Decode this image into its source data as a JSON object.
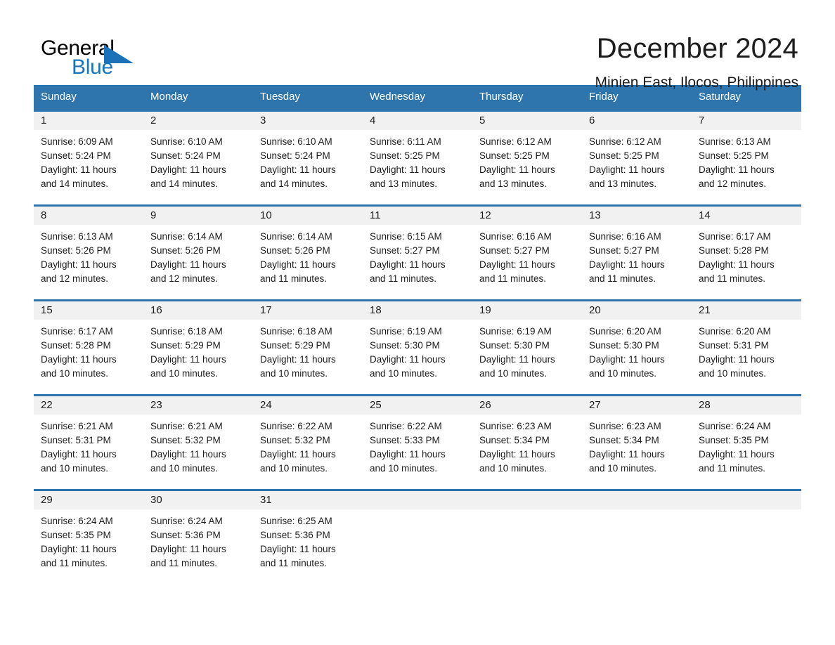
{
  "brand": {
    "name_part1": "General",
    "name_part2": "Blue",
    "accent_color": "#1b72b8"
  },
  "header": {
    "title": "December 2024",
    "subtitle": "Minien East, Ilocos, Philippines"
  },
  "theme": {
    "header_blue": "#2e75ad",
    "day_strip_gray": "#f1f1f1",
    "text_color": "#1d1d1d"
  },
  "weekdays": [
    "Sunday",
    "Monday",
    "Tuesday",
    "Wednesday",
    "Thursday",
    "Friday",
    "Saturday"
  ],
  "labels": {
    "sunrise_prefix": "Sunrise:",
    "sunset_prefix": "Sunset:",
    "daylight_prefix": "Daylight:"
  },
  "weeks": [
    [
      {
        "day": "1",
        "sunrise": "Sunrise: 6:09 AM",
        "sunset": "Sunset: 5:24 PM",
        "daylight_l1": "Daylight: 11 hours",
        "daylight_l2": "and 14 minutes."
      },
      {
        "day": "2",
        "sunrise": "Sunrise: 6:10 AM",
        "sunset": "Sunset: 5:24 PM",
        "daylight_l1": "Daylight: 11 hours",
        "daylight_l2": "and 14 minutes."
      },
      {
        "day": "3",
        "sunrise": "Sunrise: 6:10 AM",
        "sunset": "Sunset: 5:24 PM",
        "daylight_l1": "Daylight: 11 hours",
        "daylight_l2": "and 14 minutes."
      },
      {
        "day": "4",
        "sunrise": "Sunrise: 6:11 AM",
        "sunset": "Sunset: 5:25 PM",
        "daylight_l1": "Daylight: 11 hours",
        "daylight_l2": "and 13 minutes."
      },
      {
        "day": "5",
        "sunrise": "Sunrise: 6:12 AM",
        "sunset": "Sunset: 5:25 PM",
        "daylight_l1": "Daylight: 11 hours",
        "daylight_l2": "and 13 minutes."
      },
      {
        "day": "6",
        "sunrise": "Sunrise: 6:12 AM",
        "sunset": "Sunset: 5:25 PM",
        "daylight_l1": "Daylight: 11 hours",
        "daylight_l2": "and 13 minutes."
      },
      {
        "day": "7",
        "sunrise": "Sunrise: 6:13 AM",
        "sunset": "Sunset: 5:25 PM",
        "daylight_l1": "Daylight: 11 hours",
        "daylight_l2": "and 12 minutes."
      }
    ],
    [
      {
        "day": "8",
        "sunrise": "Sunrise: 6:13 AM",
        "sunset": "Sunset: 5:26 PM",
        "daylight_l1": "Daylight: 11 hours",
        "daylight_l2": "and 12 minutes."
      },
      {
        "day": "9",
        "sunrise": "Sunrise: 6:14 AM",
        "sunset": "Sunset: 5:26 PM",
        "daylight_l1": "Daylight: 11 hours",
        "daylight_l2": "and 12 minutes."
      },
      {
        "day": "10",
        "sunrise": "Sunrise: 6:14 AM",
        "sunset": "Sunset: 5:26 PM",
        "daylight_l1": "Daylight: 11 hours",
        "daylight_l2": "and 11 minutes."
      },
      {
        "day": "11",
        "sunrise": "Sunrise: 6:15 AM",
        "sunset": "Sunset: 5:27 PM",
        "daylight_l1": "Daylight: 11 hours",
        "daylight_l2": "and 11 minutes."
      },
      {
        "day": "12",
        "sunrise": "Sunrise: 6:16 AM",
        "sunset": "Sunset: 5:27 PM",
        "daylight_l1": "Daylight: 11 hours",
        "daylight_l2": "and 11 minutes."
      },
      {
        "day": "13",
        "sunrise": "Sunrise: 6:16 AM",
        "sunset": "Sunset: 5:27 PM",
        "daylight_l1": "Daylight: 11 hours",
        "daylight_l2": "and 11 minutes."
      },
      {
        "day": "14",
        "sunrise": "Sunrise: 6:17 AM",
        "sunset": "Sunset: 5:28 PM",
        "daylight_l1": "Daylight: 11 hours",
        "daylight_l2": "and 11 minutes."
      }
    ],
    [
      {
        "day": "15",
        "sunrise": "Sunrise: 6:17 AM",
        "sunset": "Sunset: 5:28 PM",
        "daylight_l1": "Daylight: 11 hours",
        "daylight_l2": "and 10 minutes."
      },
      {
        "day": "16",
        "sunrise": "Sunrise: 6:18 AM",
        "sunset": "Sunset: 5:29 PM",
        "daylight_l1": "Daylight: 11 hours",
        "daylight_l2": "and 10 minutes."
      },
      {
        "day": "17",
        "sunrise": "Sunrise: 6:18 AM",
        "sunset": "Sunset: 5:29 PM",
        "daylight_l1": "Daylight: 11 hours",
        "daylight_l2": "and 10 minutes."
      },
      {
        "day": "18",
        "sunrise": "Sunrise: 6:19 AM",
        "sunset": "Sunset: 5:30 PM",
        "daylight_l1": "Daylight: 11 hours",
        "daylight_l2": "and 10 minutes."
      },
      {
        "day": "19",
        "sunrise": "Sunrise: 6:19 AM",
        "sunset": "Sunset: 5:30 PM",
        "daylight_l1": "Daylight: 11 hours",
        "daylight_l2": "and 10 minutes."
      },
      {
        "day": "20",
        "sunrise": "Sunrise: 6:20 AM",
        "sunset": "Sunset: 5:30 PM",
        "daylight_l1": "Daylight: 11 hours",
        "daylight_l2": "and 10 minutes."
      },
      {
        "day": "21",
        "sunrise": "Sunrise: 6:20 AM",
        "sunset": "Sunset: 5:31 PM",
        "daylight_l1": "Daylight: 11 hours",
        "daylight_l2": "and 10 minutes."
      }
    ],
    [
      {
        "day": "22",
        "sunrise": "Sunrise: 6:21 AM",
        "sunset": "Sunset: 5:31 PM",
        "daylight_l1": "Daylight: 11 hours",
        "daylight_l2": "and 10 minutes."
      },
      {
        "day": "23",
        "sunrise": "Sunrise: 6:21 AM",
        "sunset": "Sunset: 5:32 PM",
        "daylight_l1": "Daylight: 11 hours",
        "daylight_l2": "and 10 minutes."
      },
      {
        "day": "24",
        "sunrise": "Sunrise: 6:22 AM",
        "sunset": "Sunset: 5:32 PM",
        "daylight_l1": "Daylight: 11 hours",
        "daylight_l2": "and 10 minutes."
      },
      {
        "day": "25",
        "sunrise": "Sunrise: 6:22 AM",
        "sunset": "Sunset: 5:33 PM",
        "daylight_l1": "Daylight: 11 hours",
        "daylight_l2": "and 10 minutes."
      },
      {
        "day": "26",
        "sunrise": "Sunrise: 6:23 AM",
        "sunset": "Sunset: 5:34 PM",
        "daylight_l1": "Daylight: 11 hours",
        "daylight_l2": "and 10 minutes."
      },
      {
        "day": "27",
        "sunrise": "Sunrise: 6:23 AM",
        "sunset": "Sunset: 5:34 PM",
        "daylight_l1": "Daylight: 11 hours",
        "daylight_l2": "and 10 minutes."
      },
      {
        "day": "28",
        "sunrise": "Sunrise: 6:24 AM",
        "sunset": "Sunset: 5:35 PM",
        "daylight_l1": "Daylight: 11 hours",
        "daylight_l2": "and 11 minutes."
      }
    ],
    [
      {
        "day": "29",
        "sunrise": "Sunrise: 6:24 AM",
        "sunset": "Sunset: 5:35 PM",
        "daylight_l1": "Daylight: 11 hours",
        "daylight_l2": "and 11 minutes."
      },
      {
        "day": "30",
        "sunrise": "Sunrise: 6:24 AM",
        "sunset": "Sunset: 5:36 PM",
        "daylight_l1": "Daylight: 11 hours",
        "daylight_l2": "and 11 minutes."
      },
      {
        "day": "31",
        "sunrise": "Sunrise: 6:25 AM",
        "sunset": "Sunset: 5:36 PM",
        "daylight_l1": "Daylight: 11 hours",
        "daylight_l2": "and 11 minutes."
      },
      {
        "day": "",
        "sunrise": "",
        "sunset": "",
        "daylight_l1": "",
        "daylight_l2": ""
      },
      {
        "day": "",
        "sunrise": "",
        "sunset": "",
        "daylight_l1": "",
        "daylight_l2": ""
      },
      {
        "day": "",
        "sunrise": "",
        "sunset": "",
        "daylight_l1": "",
        "daylight_l2": ""
      },
      {
        "day": "",
        "sunrise": "",
        "sunset": "",
        "daylight_l1": "",
        "daylight_l2": ""
      }
    ]
  ]
}
